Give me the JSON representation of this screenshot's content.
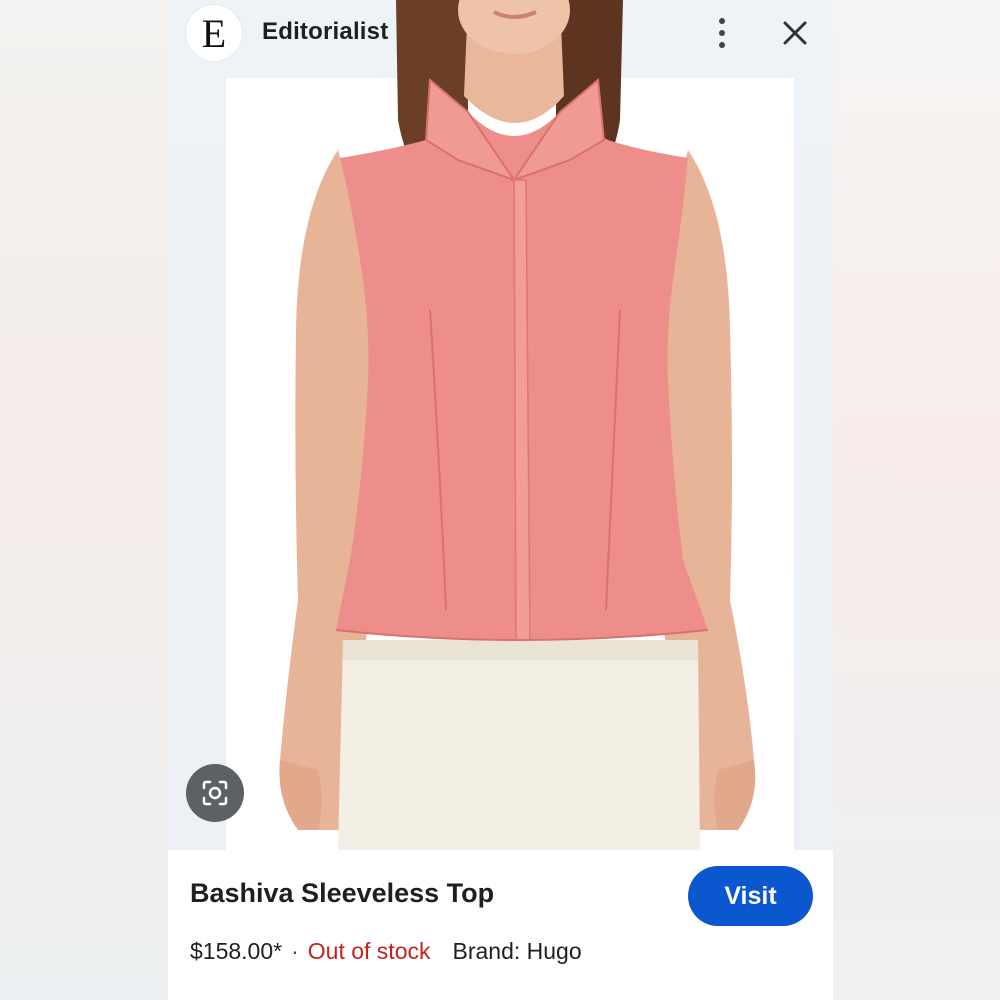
{
  "source": {
    "logo_letter": "E",
    "name": "Editorialist"
  },
  "icons": {
    "more": "more-vert-icon",
    "close": "close-icon",
    "lens": "lens-search-icon"
  },
  "product": {
    "title": "Bashiva Sleeveless Top",
    "price": "$158.00*",
    "separator": "·",
    "stock_status": "Out of stock",
    "brand": "Brand: Hugo"
  },
  "actions": {
    "visit_label": "Visit"
  },
  "colors": {
    "accent": "#0b57d0",
    "stock_status": "#c5221f",
    "top": "#ee8e8a",
    "skirt": "#f3efe4"
  }
}
